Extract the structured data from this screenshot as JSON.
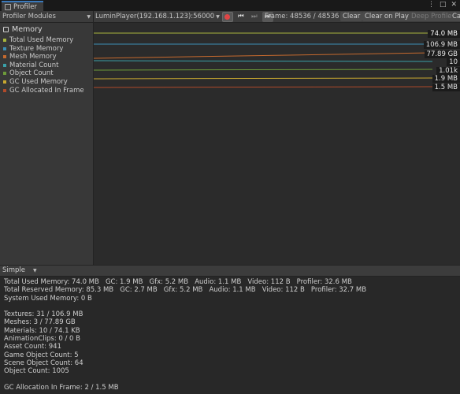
{
  "window": {
    "tab_title": "Profiler",
    "controls": [
      "⋮",
      "□",
      "✕"
    ]
  },
  "toolbar": {
    "modules_label": "Profiler Modules",
    "target_player": "LuminPlayer(192.168.1.123):56000",
    "frame_label": "Frame: 48536 / 48536",
    "clear_label": "Clear",
    "clear_on_play_label": "Clear on Play",
    "deep_profile_label": "Deep Profile",
    "overflow_label": "Ca"
  },
  "memory_module": {
    "title": "Memory",
    "series": [
      {
        "name": "Total Used Memory",
        "color": "#a8b53c",
        "value_label": "74.0 MB"
      },
      {
        "name": "Texture Memory",
        "color": "#3c8fb5",
        "value_label": "106.9 MB"
      },
      {
        "name": "Mesh Memory",
        "color": "#c66a2e",
        "value_label": "77.89 GB"
      },
      {
        "name": "Material Count",
        "color": "#3aa0a8",
        "value_label": "10"
      },
      {
        "name": "Object Count",
        "color": "#6d9b3a",
        "value_label": "1.01k"
      },
      {
        "name": "GC Used Memory",
        "color": "#c8a830",
        "value_label": "1.9 MB"
      },
      {
        "name": "GC Allocated In Frame",
        "color": "#b04a2a",
        "value_label": "1.5 MB"
      }
    ]
  },
  "details": {
    "view_mode": "Simple",
    "lines": [
      "Total Used Memory: 74.0 MB   GC: 1.9 MB   Gfx: 5.2 MB   Audio: 1.1 MB   Video: 112 B   Profiler: 32.6 MB",
      "Total Reserved Memory: 85.3 MB   GC: 2.7 MB   Gfx: 5.2 MB   Audio: 1.1 MB   Video: 112 B   Profiler: 32.7 MB",
      "System Used Memory: 0 B",
      "",
      "Textures: 31 / 106.9 MB",
      "Meshes: 3 / 77.89 GB",
      "Materials: 10 / 74.1 KB",
      "AnimationClips: 0 / 0 B",
      "Asset Count: 941",
      "Game Object Count: 5",
      "Scene Object Count: 64",
      "Object Count: 1005",
      "",
      "GC Allocation In Frame: 2 / 1.5 MB"
    ]
  }
}
